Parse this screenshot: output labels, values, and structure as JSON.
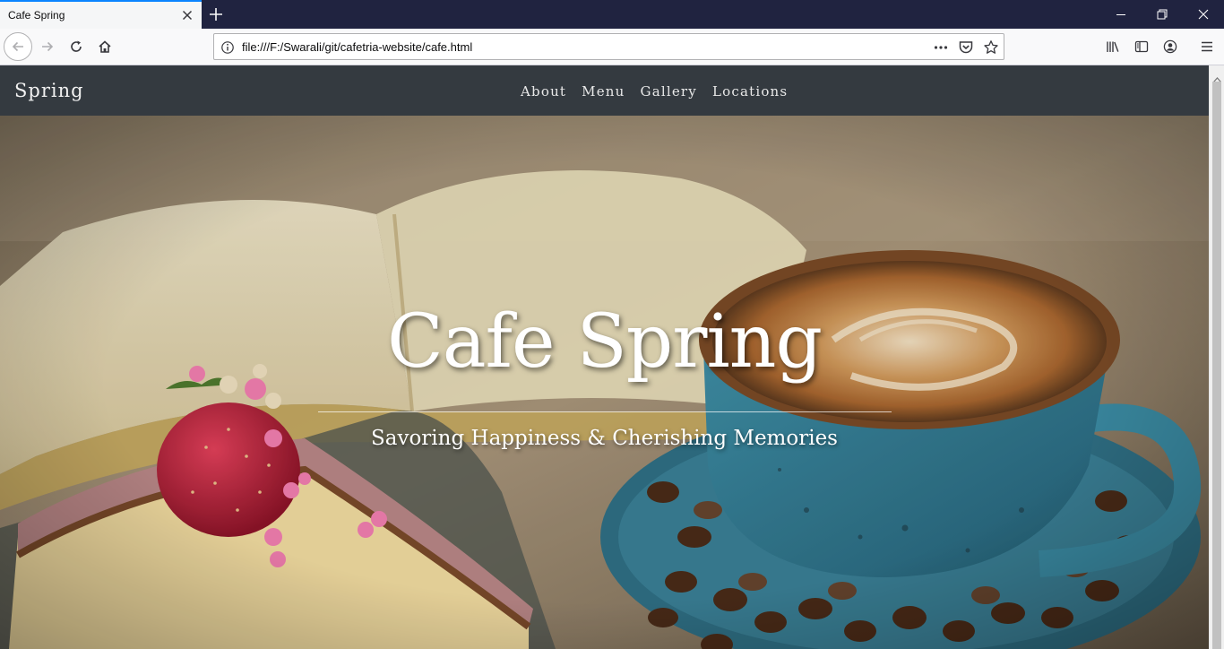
{
  "browser": {
    "tab_title": "Cafe Spring",
    "url": "file:///F:/Swarali/git/cafetria-website/cafe.html"
  },
  "site": {
    "brand": "Spring",
    "nav": [
      {
        "label": "About"
      },
      {
        "label": "Menu"
      },
      {
        "label": "Gallery"
      },
      {
        "label": "Locations"
      }
    ],
    "hero_title": "Cafe Spring",
    "hero_subtitle": "Savoring Happiness & Cherishing Memories"
  },
  "colors": {
    "navbar": "#343a40",
    "tabbar": "#202340",
    "accent": "#0a84ff"
  },
  "icons": [
    "close-icon",
    "plus-icon",
    "minimize-icon",
    "restore-icon",
    "back-icon",
    "forward-icon",
    "reload-icon",
    "home-icon",
    "info-icon",
    "more-icon",
    "pocket-icon",
    "star-icon",
    "library-icon",
    "sidebar-icon",
    "account-icon",
    "menu-icon"
  ]
}
